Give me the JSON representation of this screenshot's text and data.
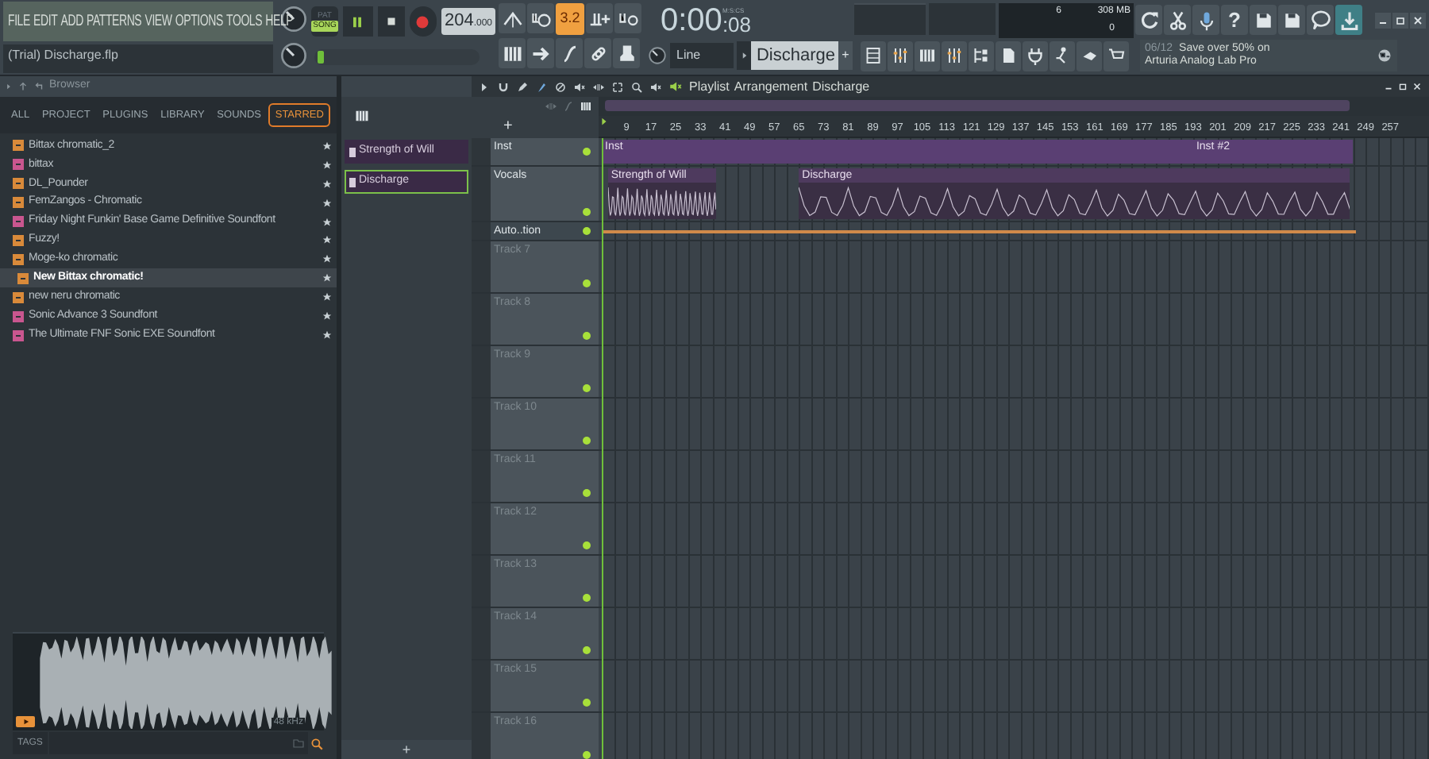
{
  "menu": [
    "FILE",
    "EDIT",
    "ADD",
    "PATTERNS",
    "VIEW",
    "OPTIONS",
    "TOOLS",
    "HELP"
  ],
  "project_title": "(Trial) Discharge.flp",
  "transport": {
    "pat_label": "PAT",
    "song_label": "SONG",
    "song_selected": true,
    "tempo": "204",
    "tempo_fraction": ".000",
    "step": "3.2"
  },
  "master_pitch": {
    "level": 0.02
  },
  "time": {
    "main": "0:00",
    "sub": ":08",
    "unit": "M:S:CS"
  },
  "cpu": {
    "value": "6",
    "memory": "308 MB",
    "polyphony": "0"
  },
  "help_label": "?",
  "snap": "Line",
  "pattern_selector": {
    "label": "Discharge",
    "plus": "+"
  },
  "hint": {
    "date": "06/12",
    "line1": "Save over 50% on",
    "line2": "Arturia Analog Lab Pro"
  },
  "browser": {
    "title": "Browser",
    "tabs": [
      {
        "label": "ALL",
        "selected": false
      },
      {
        "label": "PROJECT",
        "selected": false
      },
      {
        "label": "PLUGINS",
        "selected": false
      },
      {
        "label": "LIBRARY",
        "selected": false
      },
      {
        "label": "SOUNDS",
        "selected": false
      },
      {
        "label": "STARRED",
        "selected": true
      }
    ],
    "items": [
      {
        "label": "Bittax chromatic_2",
        "kind": "preset",
        "selected": false
      },
      {
        "label": "bittax",
        "kind": "soundfont",
        "selected": false
      },
      {
        "label": "DL_Pounder",
        "kind": "preset",
        "selected": false
      },
      {
        "label": "FemZangos - Chromatic",
        "kind": "preset",
        "selected": false
      },
      {
        "label": "Friday Night Funkin' Base Game Definitive Soundfont",
        "kind": "soundfont",
        "selected": false
      },
      {
        "label": "Fuzzy!",
        "kind": "preset",
        "selected": false
      },
      {
        "label": "Moge-ko chromatic",
        "kind": "preset",
        "selected": false
      },
      {
        "label": "New Bittax chromatic!",
        "kind": "preset",
        "selected": true
      },
      {
        "label": "new neru chromatic",
        "kind": "preset",
        "selected": false
      },
      {
        "label": "Sonic Advance 3 Soundfont",
        "kind": "soundfont",
        "selected": false
      },
      {
        "label": "The Ultimate FNF Sonic EXE Soundfont",
        "kind": "soundfont",
        "selected": false
      }
    ],
    "sample_rate": "48 kHz",
    "tags_label": "TAGS"
  },
  "patterns": [
    {
      "label": "Strength of Will",
      "selected": false
    },
    {
      "label": "Discharge",
      "selected": true
    }
  ],
  "pattern_add": "+",
  "playlist": {
    "title": "Playlist",
    "path": [
      "Arrangement",
      "Discharge"
    ],
    "ruler": [
      "9",
      "17",
      "25",
      "33",
      "41",
      "49",
      "57",
      "65",
      "73",
      "81",
      "89",
      "97",
      "105",
      "113",
      "121",
      "129",
      "137",
      "145",
      "153",
      "161",
      "169",
      "177",
      "185",
      "193",
      "201",
      "209",
      "217",
      "225",
      "233",
      "241",
      "249",
      "257"
    ],
    "tracks": [
      {
        "name": "Inst",
        "kind": "audio",
        "enabled": true,
        "clips": [
          {
            "label": "Inst"
          },
          {
            "label": "Inst #2"
          }
        ]
      },
      {
        "name": "Vocals",
        "kind": "pattern",
        "enabled": true,
        "clips": [
          {
            "label": "Strength of Will"
          },
          {
            "label": "Discharge"
          }
        ]
      },
      {
        "name": "Auto..tion",
        "kind": "automation",
        "enabled": true
      },
      {
        "name": "Track 7",
        "kind": "empty",
        "enabled": true
      },
      {
        "name": "Track 8",
        "kind": "empty",
        "enabled": true
      },
      {
        "name": "Track 9",
        "kind": "empty",
        "enabled": true
      },
      {
        "name": "Track 10",
        "kind": "empty",
        "enabled": true
      },
      {
        "name": "Track 11",
        "kind": "empty",
        "enabled": true
      },
      {
        "name": "Track 12",
        "kind": "empty",
        "enabled": true
      },
      {
        "name": "Track 13",
        "kind": "empty",
        "enabled": true
      },
      {
        "name": "Track 14",
        "kind": "empty",
        "enabled": true
      },
      {
        "name": "Track 15",
        "kind": "empty",
        "enabled": true
      },
      {
        "name": "Track 16",
        "kind": "empty",
        "enabled": true
      }
    ]
  }
}
